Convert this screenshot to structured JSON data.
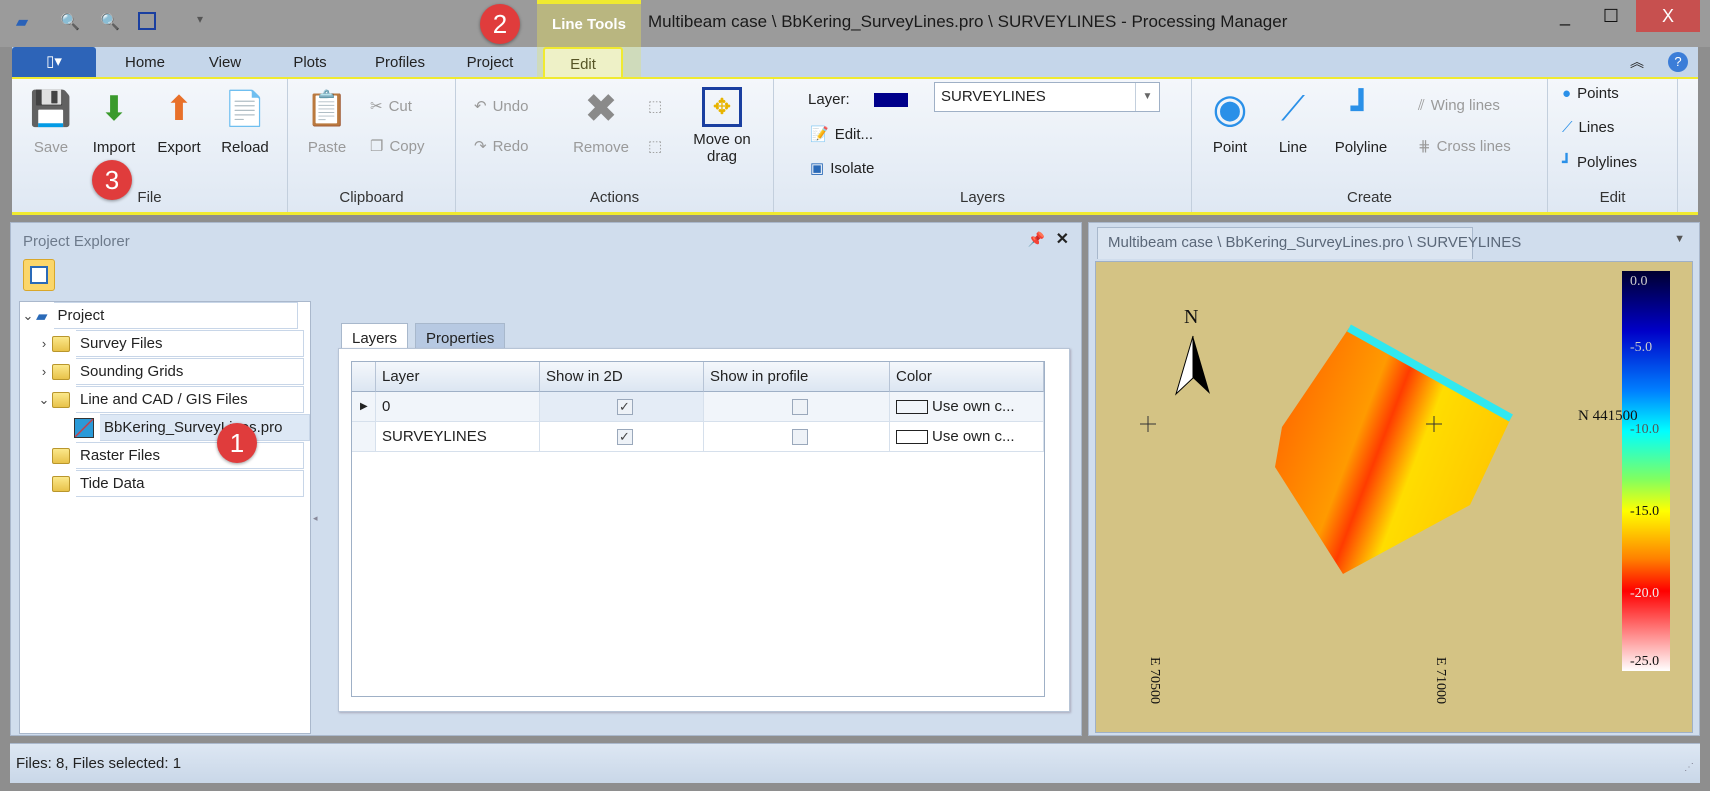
{
  "window": {
    "title": "Multibeam case \\ BbKering_SurveyLines.pro \\ SURVEYLINES - Processing Manager",
    "context_tab": "Line Tools",
    "minimize": "_",
    "maximize": "☐",
    "close": "X"
  },
  "ribbon_tabs": [
    "Home",
    "View",
    "Plots",
    "Profiles",
    "Project",
    "Edit"
  ],
  "ribbon": {
    "file": {
      "label": "File",
      "save": "Save",
      "import": "Import",
      "export": "Export",
      "reload": "Reload"
    },
    "clipboard": {
      "label": "Clipboard",
      "paste": "Paste",
      "cut": "Cut",
      "copy": "Copy"
    },
    "actions": {
      "label": "Actions",
      "undo": "Undo",
      "redo": "Redo",
      "remove": "Remove",
      "move_on_drag": "Move on drag"
    },
    "layers": {
      "label": "Layers",
      "layer_label": "Layer:",
      "layer_value": "SURVEYLINES",
      "layer_color": "#00008b",
      "edit": "Edit...",
      "isolate": "Isolate"
    },
    "create": {
      "label": "Create",
      "point": "Point",
      "line": "Line",
      "polyline": "Polyline",
      "wing_lines": "Wing lines",
      "cross_lines": "Cross lines"
    },
    "edit": {
      "label": "Edit",
      "points": "Points",
      "lines": "Lines",
      "polylines": "Polylines"
    }
  },
  "badges": [
    "1",
    "2",
    "3"
  ],
  "explorer": {
    "title": "Project Explorer",
    "tree": [
      {
        "label": "Project"
      },
      {
        "label": "Survey Files"
      },
      {
        "label": "Sounding Grids"
      },
      {
        "label": "Line and CAD / GIS Files"
      },
      {
        "label": "BbKering_SurveyLines.pro"
      },
      {
        "label": "Raster Files"
      },
      {
        "label": "Tide Data"
      }
    ],
    "tabs": [
      "Layers",
      "Properties"
    ],
    "grid": {
      "columns": [
        "Layer",
        "Show in 2D",
        "Show in profile",
        "Color"
      ],
      "rows": [
        {
          "layer": "0",
          "show2d": "✓",
          "profile": "",
          "color": "Use own c..."
        },
        {
          "layer": "SURVEYLINES",
          "show2d": "✓",
          "profile": "",
          "color": "Use own c..."
        }
      ]
    }
  },
  "map": {
    "tab": "Multibeam case \\ BbKering_SurveyLines.pro \\ SURVEYLINES",
    "north": "N",
    "northing": "N 441500",
    "east1": "E 70500",
    "east2": "E 71000",
    "colorbar": [
      "0.0",
      "-5.0",
      "-10.0",
      "-15.0",
      "-20.0",
      "-25.0"
    ]
  },
  "status": {
    "text": "Files: 8, Files selected: 1"
  }
}
